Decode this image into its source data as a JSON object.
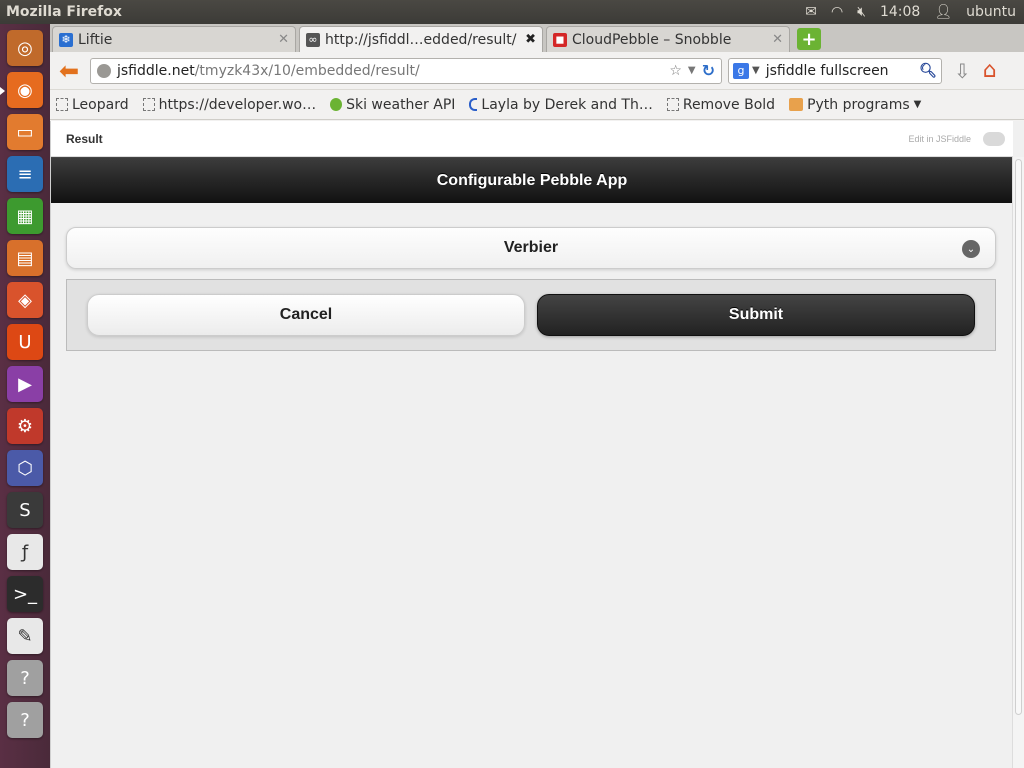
{
  "panel": {
    "window_title": "Mozilla Firefox",
    "time": "14:08",
    "user": "ubuntu"
  },
  "launcher": {
    "items": [
      {
        "name": "dash-home-icon",
        "color": "#c06a2b",
        "glyph": "◎"
      },
      {
        "name": "firefox-icon",
        "color": "#e66b1f",
        "glyph": "◉"
      },
      {
        "name": "files-icon",
        "color": "#e27b2f",
        "glyph": "▭"
      },
      {
        "name": "writer-icon",
        "color": "#2b6db3",
        "glyph": "≡"
      },
      {
        "name": "calc-icon",
        "color": "#3d9a2f",
        "glyph": "▦"
      },
      {
        "name": "impress-icon",
        "color": "#d8702b",
        "glyph": "▤"
      },
      {
        "name": "software-center-icon",
        "color": "#d9532c",
        "glyph": "◈"
      },
      {
        "name": "ubuntu-one-icon",
        "color": "#dd4814",
        "glyph": "U"
      },
      {
        "name": "video-editor-icon",
        "color": "#8a3fa6",
        "glyph": "▶"
      },
      {
        "name": "system-settings-icon",
        "color": "#c0392b",
        "glyph": "⚙"
      },
      {
        "name": "graph-app-icon",
        "color": "#4b5aa8",
        "glyph": "⬡"
      },
      {
        "name": "sublime-text-icon",
        "color": "#3a3a3a",
        "glyph": "S"
      },
      {
        "name": "font-viewer-icon",
        "color": "#e8e8e8",
        "glyph": "ƒ"
      },
      {
        "name": "terminal-icon",
        "color": "#2c2c2c",
        "glyph": ">_"
      },
      {
        "name": "text-editor-icon",
        "color": "#e8e8e8",
        "glyph": "✎"
      },
      {
        "name": "unknown-app-icon",
        "color": "#a0a0a0",
        "glyph": "?"
      },
      {
        "name": "unknown-app-2-icon",
        "color": "#a0a0a0",
        "glyph": "?"
      }
    ]
  },
  "tabs": [
    {
      "label": "Liftie",
      "icon_color": "#2a6fd1",
      "icon": "❄",
      "active": false
    },
    {
      "label": "http://jsfiddl…edded/result/",
      "icon_color": "#555555",
      "icon": "∞",
      "active": true
    },
    {
      "label": "CloudPebble – Snobble",
      "icon_color": "#d42727",
      "icon": "◼",
      "active": false
    }
  ],
  "nav": {
    "url_domain": "jsfiddle.net",
    "url_path": "/tmyzk43x/10/embedded/result/",
    "search_query": "jsfiddle fullscreen"
  },
  "bookmarks": [
    {
      "label": "Leopard",
      "type": "dashed"
    },
    {
      "label": "https://developer.wo…",
      "type": "dashed"
    },
    {
      "label": "Ski weather API",
      "type": "solid"
    },
    {
      "label": "Layla by Derek and Th…",
      "type": "blue"
    },
    {
      "label": "Remove Bold",
      "type": "dashed"
    },
    {
      "label": "Pyth programs",
      "type": "folder"
    }
  ],
  "result_header": {
    "label": "Result",
    "edit_link": "Edit in JSFiddle"
  },
  "app": {
    "title": "Configurable Pebble App",
    "selected_resort": "Verbier",
    "cancel_label": "Cancel",
    "submit_label": "Submit"
  }
}
